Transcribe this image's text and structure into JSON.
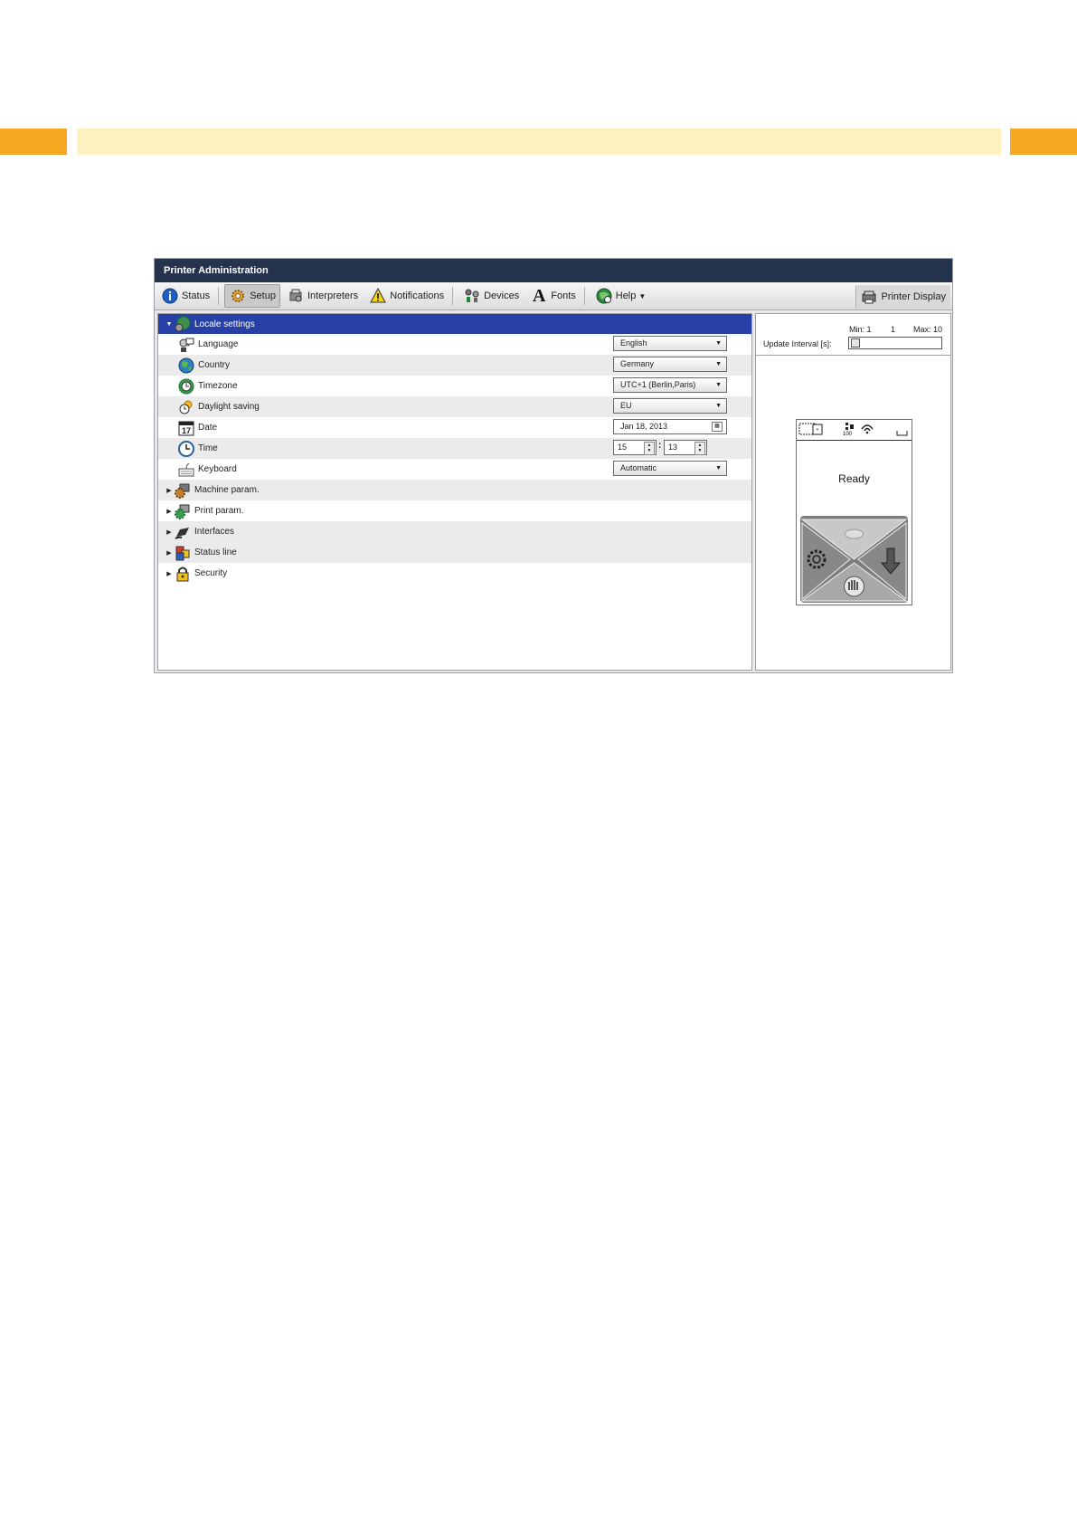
{
  "window": {
    "title": "Printer Administration"
  },
  "toolbar": {
    "status": "Status",
    "setup": "Setup",
    "interpreters": "Interpreters",
    "notifications": "Notifications",
    "devices": "Devices",
    "fonts": "Fonts",
    "help": "Help",
    "printer_display": "Printer Display"
  },
  "tree": {
    "locale": "Locale settings",
    "language": {
      "label": "Language",
      "value": "English"
    },
    "country": {
      "label": "Country",
      "value": "Germany"
    },
    "timezone": {
      "label": "Timezone",
      "value": "UTC+1 (Berlin,Paris)"
    },
    "daylight": {
      "label": "Daylight saving",
      "value": "EU"
    },
    "date": {
      "label": "Date",
      "value": "Jan 18, 2013"
    },
    "time": {
      "label": "Time",
      "hour": "15",
      "minute": "13"
    },
    "keyboard": {
      "label": "Keyboard",
      "value": "Automatic"
    },
    "machine": "Machine param.",
    "print": "Print param.",
    "interfaces": "Interfaces",
    "statusline": "Status line",
    "security": "Security"
  },
  "display": {
    "min": "Min: 1",
    "current": "1",
    "max": "Max: 10",
    "interval_label": "Update Interval [s]:",
    "network_value": "100",
    "ready": "Ready"
  },
  "colors": {
    "accent_orange": "#f7a823",
    "band_yellow": "#fdf1bf",
    "titlebar": "#26334f",
    "selection": "#2740a8"
  }
}
